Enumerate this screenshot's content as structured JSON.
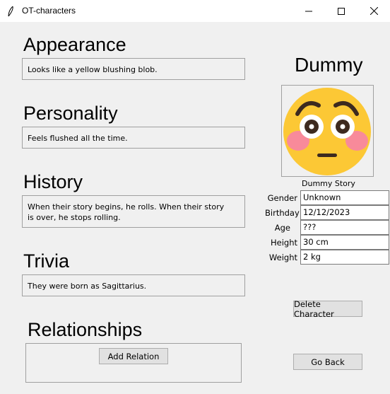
{
  "window": {
    "title": "OT-characters"
  },
  "sections": {
    "appearance": {
      "heading": "Appearance",
      "text": "Looks like a yellow blushing blob."
    },
    "personality": {
      "heading": "Personality",
      "text": "Feels flushed all the time."
    },
    "history": {
      "heading": "History",
      "text_line1": "When their story begins, he rolls. When their story",
      "text_line2": "is over, he stops rolling."
    },
    "trivia": {
      "heading": "Trivia",
      "text": "They were born as Sagittarius."
    },
    "relationships": {
      "heading": "Relationships",
      "add_label": "Add Relation"
    }
  },
  "character": {
    "name": "Dummy",
    "story": "Dummy Story",
    "portrait_icon": "flushed-face-emoji",
    "fields": {
      "gender": {
        "label": "Gender",
        "value": "Unknown"
      },
      "birthday": {
        "label": "Birthday",
        "value": "12/12/2023"
      },
      "age": {
        "label": "Age",
        "value": "???"
      },
      "height": {
        "label": "Height",
        "value": "30 cm"
      },
      "weight": {
        "label": "Weight",
        "value": "2 kg"
      }
    }
  },
  "actions": {
    "delete_label": "Delete Character",
    "back_label": "Go Back"
  },
  "colors": {
    "emoji_face": "#fcc835",
    "emoji_blush": "#f88a9a",
    "window_bg": "#f0f0f0"
  }
}
